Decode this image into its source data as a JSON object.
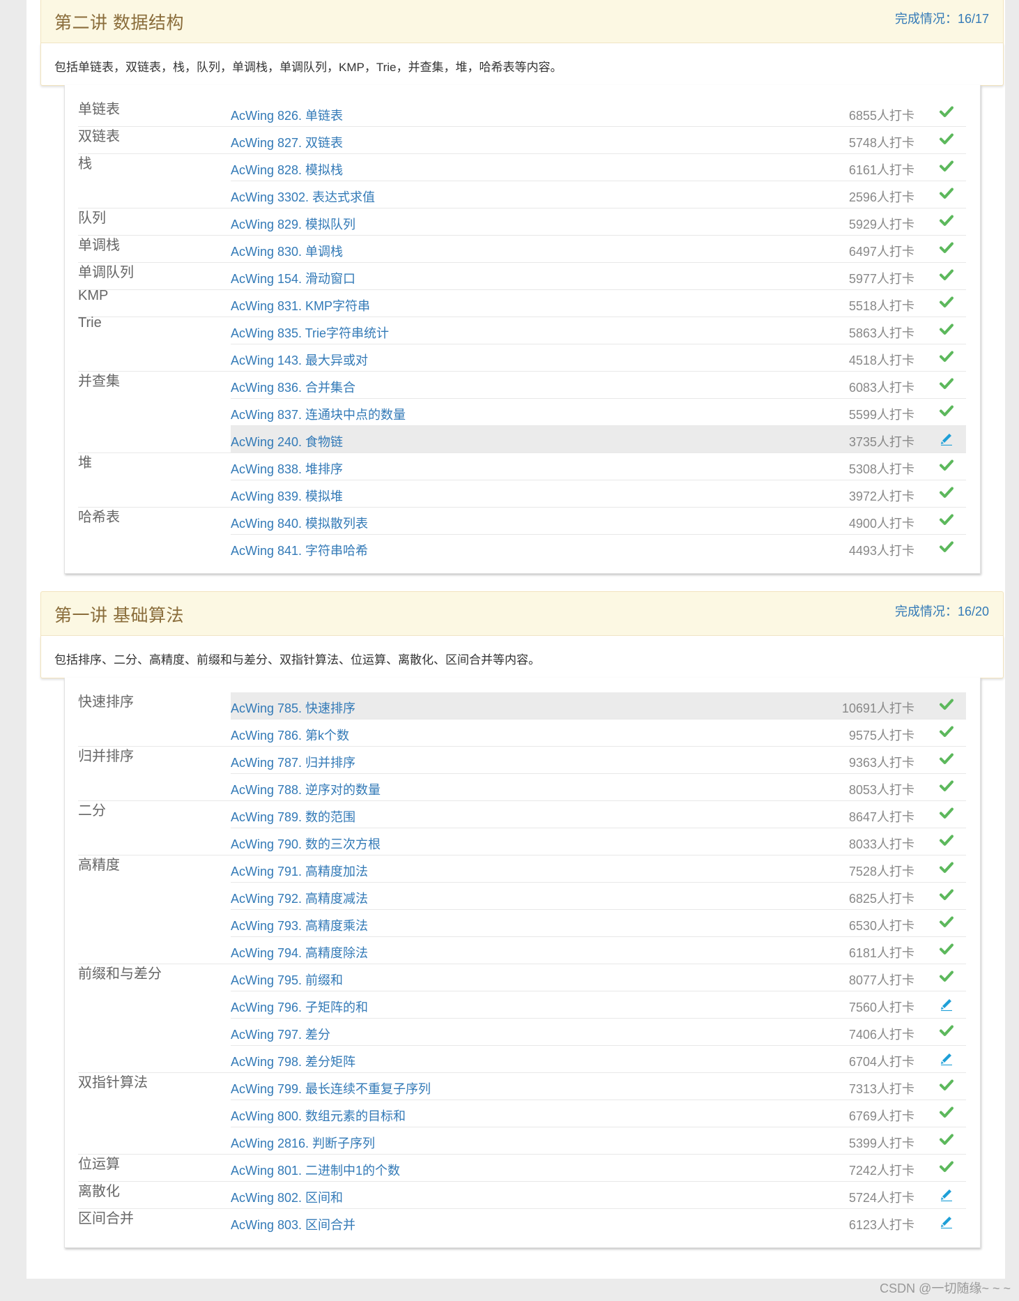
{
  "colors": {
    "check": "#5cb85c",
    "pencil": "#1e9fd7",
    "link": "#337ab7"
  },
  "sections": [
    {
      "title": "第二讲 数据结构",
      "progress": "完成情况：16/17",
      "description": "包括单链表，双链表，栈，队列，单调栈，单调队列，KMP，Trie，并查集，堆，哈希表等内容。",
      "rows": [
        {
          "category": "单链表",
          "problem": "AcWing 826. 单链表",
          "count": "6855人打卡",
          "status": "done"
        },
        {
          "category": "双链表",
          "problem": "AcWing 827. 双链表",
          "count": "5748人打卡",
          "status": "done"
        },
        {
          "category": "栈",
          "problem": "AcWing 828. 模拟栈",
          "count": "6161人打卡",
          "status": "done"
        },
        {
          "category": "",
          "problem": "AcWing 3302. 表达式求值",
          "count": "2596人打卡",
          "status": "done"
        },
        {
          "category": "队列",
          "problem": "AcWing 829. 模拟队列",
          "count": "5929人打卡",
          "status": "done"
        },
        {
          "category": "单调栈",
          "problem": "AcWing 830. 单调栈",
          "count": "6497人打卡",
          "status": "done"
        },
        {
          "category": "单调队列",
          "problem": "AcWing 154. 滑动窗口",
          "count": "5977人打卡",
          "status": "done"
        },
        {
          "category": "KMP",
          "problem": "AcWing 831. KMP字符串",
          "count": "5518人打卡",
          "status": "done"
        },
        {
          "category": "Trie",
          "problem": "AcWing 835. Trie字符串统计",
          "count": "5863人打卡",
          "status": "done"
        },
        {
          "category": "",
          "problem": "AcWing 143. 最大异或对",
          "count": "4518人打卡",
          "status": "done"
        },
        {
          "category": "并查集",
          "problem": "AcWing 836. 合并集合",
          "count": "6083人打卡",
          "status": "done"
        },
        {
          "category": "",
          "problem": "AcWing 837. 连通块中点的数量",
          "count": "5599人打卡",
          "status": "done"
        },
        {
          "category": "",
          "problem": "AcWing 240. 食物链",
          "count": "3735人打卡",
          "status": "edit",
          "highlight": true
        },
        {
          "category": "堆",
          "problem": "AcWing 838. 堆排序",
          "count": "5308人打卡",
          "status": "done"
        },
        {
          "category": "",
          "problem": "AcWing 839. 模拟堆",
          "count": "3972人打卡",
          "status": "done"
        },
        {
          "category": "哈希表",
          "problem": "AcWing 840. 模拟散列表",
          "count": "4900人打卡",
          "status": "done"
        },
        {
          "category": "",
          "problem": "AcWing 841. 字符串哈希",
          "count": "4493人打卡",
          "status": "done"
        }
      ]
    },
    {
      "title": "第一讲 基础算法",
      "progress": "完成情况：16/20",
      "description": "包括排序、二分、高精度、前缀和与差分、双指针算法、位运算、离散化、区间合并等内容。",
      "rows": [
        {
          "category": "快速排序",
          "problem": "AcWing 785. 快速排序",
          "count": "10691人打卡",
          "status": "done",
          "highlight": true
        },
        {
          "category": "",
          "problem": "AcWing 786. 第k个数",
          "count": "9575人打卡",
          "status": "done"
        },
        {
          "category": "归并排序",
          "problem": "AcWing 787. 归并排序",
          "count": "9363人打卡",
          "status": "done"
        },
        {
          "category": "",
          "problem": "AcWing 788. 逆序对的数量",
          "count": "8053人打卡",
          "status": "done"
        },
        {
          "category": "二分",
          "problem": "AcWing 789. 数的范围",
          "count": "8647人打卡",
          "status": "done"
        },
        {
          "category": "",
          "problem": "AcWing 790. 数的三次方根",
          "count": "8033人打卡",
          "status": "done"
        },
        {
          "category": "高精度",
          "problem": "AcWing 791. 高精度加法",
          "count": "7528人打卡",
          "status": "done"
        },
        {
          "category": "",
          "problem": "AcWing 792. 高精度减法",
          "count": "6825人打卡",
          "status": "done"
        },
        {
          "category": "",
          "problem": "AcWing 793. 高精度乘法",
          "count": "6530人打卡",
          "status": "done"
        },
        {
          "category": "",
          "problem": "AcWing 794. 高精度除法",
          "count": "6181人打卡",
          "status": "done"
        },
        {
          "category": "前缀和与差分",
          "problem": "AcWing 795. 前缀和",
          "count": "8077人打卡",
          "status": "done"
        },
        {
          "category": "",
          "problem": "AcWing 796. 子矩阵的和",
          "count": "7560人打卡",
          "status": "edit"
        },
        {
          "category": "",
          "problem": "AcWing 797. 差分",
          "count": "7406人打卡",
          "status": "done"
        },
        {
          "category": "",
          "problem": "AcWing 798. 差分矩阵",
          "count": "6704人打卡",
          "status": "edit"
        },
        {
          "category": "双指针算法",
          "problem": "AcWing 799. 最长连续不重复子序列",
          "count": "7313人打卡",
          "status": "done"
        },
        {
          "category": "",
          "problem": "AcWing 800. 数组元素的目标和",
          "count": "6769人打卡",
          "status": "done"
        },
        {
          "category": "",
          "problem": "AcWing 2816. 判断子序列",
          "count": "5399人打卡",
          "status": "done"
        },
        {
          "category": "位运算",
          "problem": "AcWing 801. 二进制中1的个数",
          "count": "7242人打卡",
          "status": "done"
        },
        {
          "category": "离散化",
          "problem": "AcWing 802. 区间和",
          "count": "5724人打卡",
          "status": "edit"
        },
        {
          "category": "区间合并",
          "problem": "AcWing 803. 区间合并",
          "count": "6123人打卡",
          "status": "edit"
        }
      ]
    }
  ],
  "footer": "CSDN @一切随缘~ ~ ~"
}
